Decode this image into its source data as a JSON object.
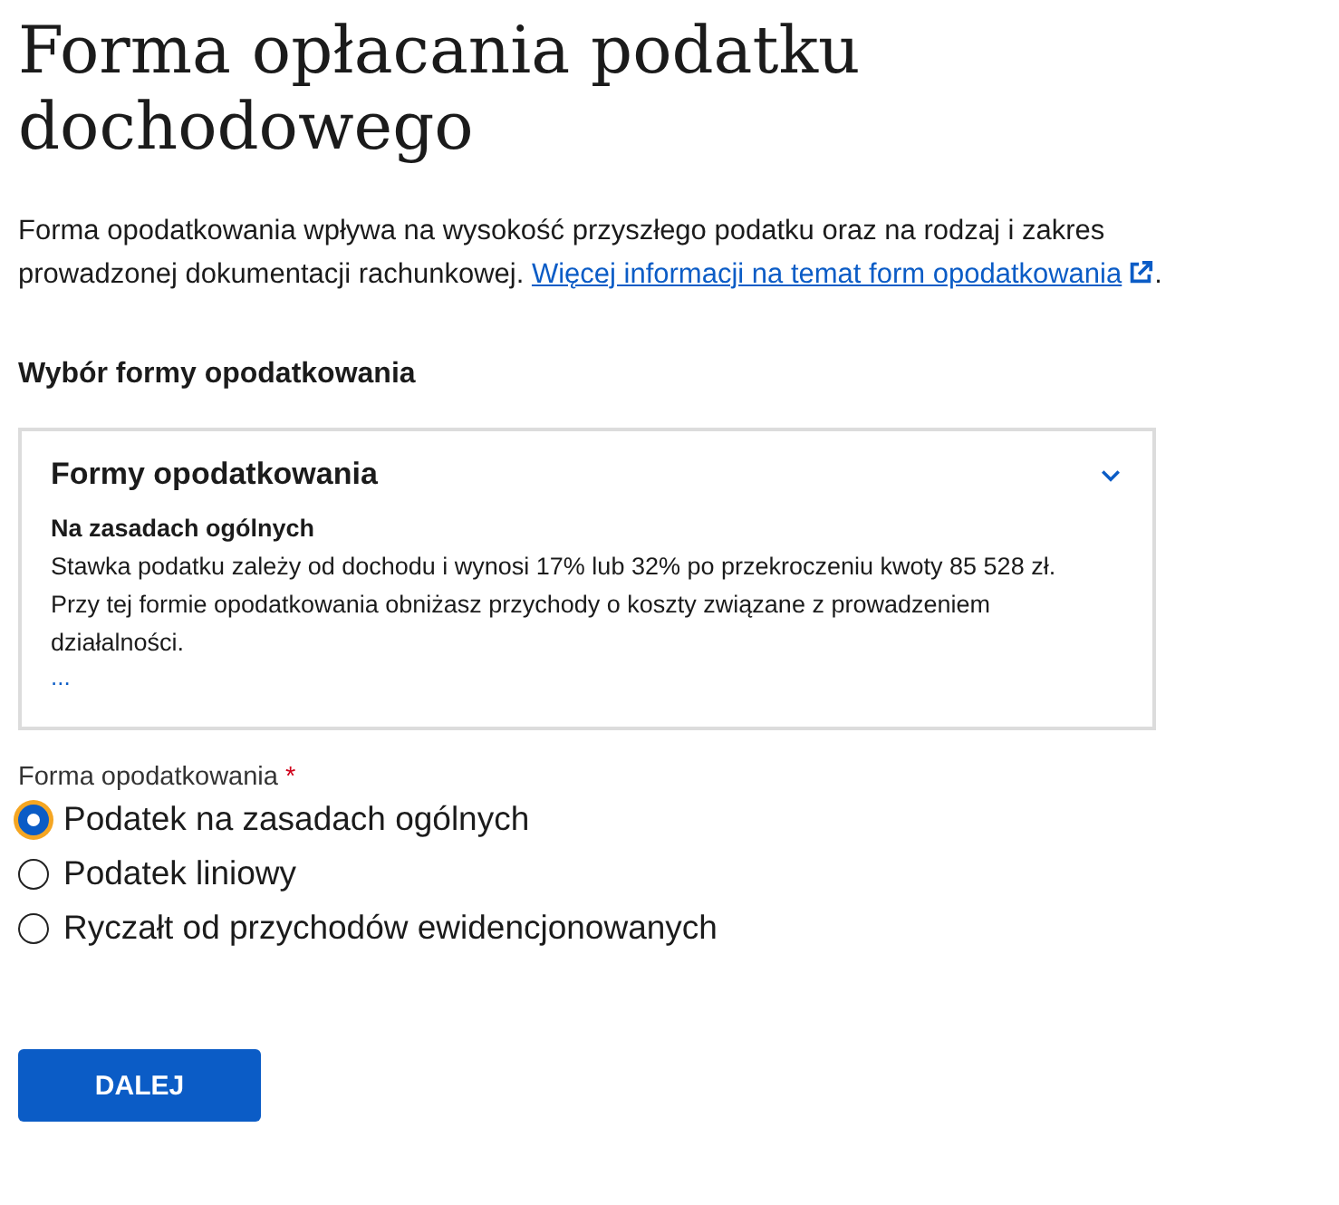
{
  "page": {
    "title": "Forma opłacania podatku dochodowego"
  },
  "intro": {
    "text": "Forma opodatkowania wpływa na wysokość przyszłego podatku oraz na rodzaj i zakres prowadzonej dokumentacji rachunkowej.",
    "link": "Więcej informacji na temat form opodatkowania",
    "tail": "."
  },
  "section": {
    "title": "Wybór formy opodatkowania"
  },
  "accordion": {
    "title": "Formy opodatkowania",
    "expanded": true,
    "subtitle": "Na zasadach ogólnych",
    "text": "Stawka podatku zależy od dochodu i wynosi 17% lub 32% po przekroczeniu kwoty 85 528 zł. Przy tej formie opodatkowania obniżasz przychody o koszty związane z prowadzeniem działalności.",
    "more": "..."
  },
  "radio_group": {
    "label": "Forma opodatkowania",
    "required_mark": "*",
    "options": [
      {
        "label": "Podatek na zasadach ogólnych",
        "selected": true
      },
      {
        "label": "Podatek liniowy",
        "selected": false
      },
      {
        "label": "Ryczałt od przychodów ewidencjonowanych",
        "selected": false
      }
    ]
  },
  "button": {
    "label": "DALEJ"
  }
}
